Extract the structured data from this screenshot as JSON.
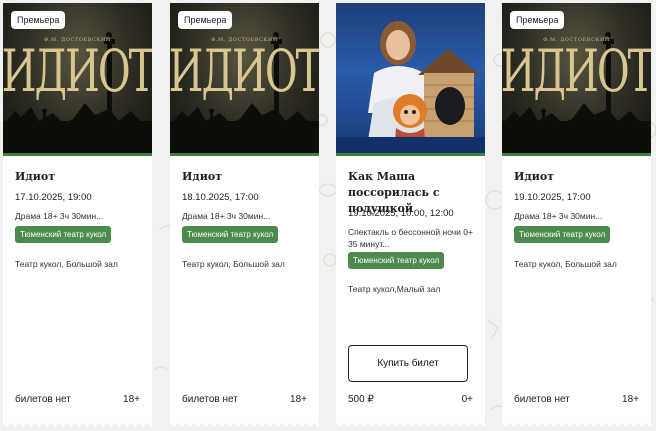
{
  "events": [
    {
      "badge": "Премьера",
      "poster_type": "idiot",
      "poster_author": "Ф.М. ДОСТОЕВСКИЙ",
      "poster_title": "ИДИОТ",
      "title": "Идиот",
      "datetime": "17.10.2025, 19:00",
      "genre": "Драма 18+ 3ч 30мин...",
      "theatre": "Тюменский театр кукол",
      "hall": "Театр кукол, Большой зал",
      "price": "билетов нет",
      "age": "18+"
    },
    {
      "badge": "Премьера",
      "poster_type": "idiot",
      "poster_author": "Ф.М. ДОСТОЕВСКИЙ",
      "poster_title": "ИДИОТ",
      "title": "Идиот",
      "datetime": "18.10.2025, 17:00",
      "genre": "Драма 18+ 3ч 30мин...",
      "theatre": "Тюменский театр кукол",
      "hall": "Театр кукол, Большой зал",
      "price": "билетов нет",
      "age": "18+"
    },
    {
      "badge": "",
      "poster_type": "photo",
      "title": "Как Маша поссорилась с подушкой",
      "datetime": "19.10.2025, 10:00, 12:00",
      "genre": "Спектакль о бессонной ночи 0+ 35 минут...",
      "theatre": "Тюменский театр кукол",
      "hall": "Театр кукол,Малый зал",
      "buy_label": "Купить билет",
      "price": "500 ₽",
      "age": "0+"
    },
    {
      "badge": "Премьера",
      "poster_type": "idiot",
      "poster_author": "Ф.М. ДОСТОЕВСКИЙ",
      "poster_title": "ИДИОТ",
      "title": "Идиот",
      "datetime": "19.10.2025, 17:00",
      "genre": "Драма 18+ 3ч 30мин...",
      "theatre": "Тюменский театр кукол",
      "hall": "Театр кукол, Большой зал",
      "price": "билетов нет",
      "age": "18+"
    }
  ],
  "colors": {
    "accent_green": "#4d8a4d",
    "divider_green": "#3f7e3f",
    "page_background": "#f1f1ef"
  }
}
